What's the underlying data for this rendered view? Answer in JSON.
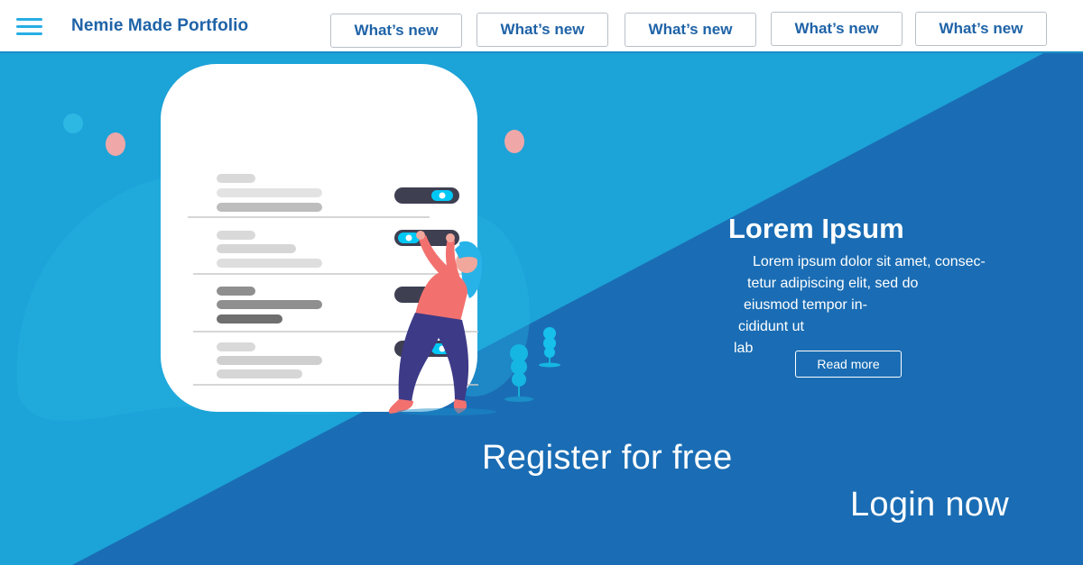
{
  "header": {
    "brand": "Nemie Made Portfolio",
    "menu_icon": "hamburger-menu-icon",
    "nav": [
      {
        "label": "What’s new"
      },
      {
        "label": "What’s new"
      },
      {
        "label": "What’s new"
      },
      {
        "label": "What’s new"
      },
      {
        "label": "What’s new"
      }
    ]
  },
  "hero": {
    "title": "Lorem Ipsum",
    "body_lines": [
      "Lorem ipsum dolor sit amet, consec-",
      "tetur adipiscing elit, sed do",
      "eiusmod tempor in-",
      "cididunt ut",
      "lab"
    ],
    "read_more": "Read more",
    "register": "Register for free",
    "login": "Login now",
    "illustration": "woman-toggling-settings-illustration"
  },
  "colors": {
    "light_blue": "#1ca3d8",
    "dark_blue": "#1a6db4",
    "brand_text": "#1f63a7",
    "accent": "#27aee4"
  }
}
